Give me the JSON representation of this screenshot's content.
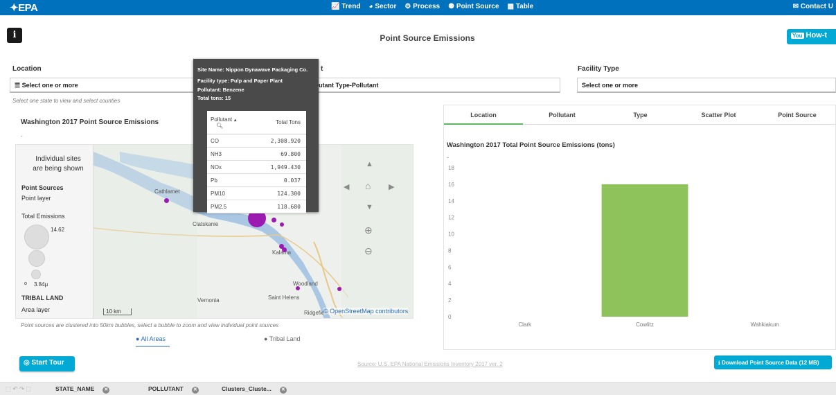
{
  "header": {
    "logo": "✦EPA",
    "nav": [
      {
        "icon": "trend-icon",
        "label": "Trend"
      },
      {
        "icon": "sector-icon",
        "label": "Sector"
      },
      {
        "icon": "process-icon",
        "label": "Process"
      },
      {
        "icon": "map-pin-icon",
        "label": "Point Source"
      },
      {
        "icon": "table-icon",
        "label": "Table"
      }
    ],
    "contact": "Contact U"
  },
  "page": {
    "title": "Point Source Emissions",
    "howto_label": "How-t",
    "youtube_badge": "You"
  },
  "filters": {
    "location_label": "Location",
    "location_placeholder": "Select one or more",
    "pollutant_label": "t",
    "pollutant_placeholder": "utant Type-Pollutant",
    "facility_label": "Facility Type",
    "facility_placeholder": "Select one or more",
    "hint": "Select one state to view and select counties"
  },
  "map_section": {
    "title": "Washington 2017 Point Source Emissions",
    "dash": "-",
    "legend": {
      "individual_line1": "Individual sites",
      "individual_line2": "are being shown",
      "point_sources": "Point Sources",
      "point_layer": "Point layer",
      "total_emissions": "Total Emissions",
      "max_value": "14.62",
      "min_value": "3.84μ",
      "min_marker": "o",
      "tribal_land": "TRIBAL LAND",
      "area_layer": "Area layer"
    },
    "places": [
      "Cathlamet",
      "Clatskanie",
      "Kalama",
      "Woodland",
      "Saint Helens",
      "Vernonia",
      "Ridgefield"
    ],
    "scale": "10 km",
    "attribution": "© OpenStreetMap contributors",
    "footnote": "Point sources are clustered into 50km bubbles, select a bubble to zoom and view individual point sources",
    "area_tabs": [
      "All Areas",
      "Tribal Land"
    ]
  },
  "tooltip": {
    "site": "Site Name: Nippon Dynawave Packaging Co.",
    "facility": "Facility type: Pulp and Paper Plant",
    "pollutant": "Pollutant: Benzene",
    "total": "Total tons: 15",
    "table_headers": [
      "Pollutant",
      "Total Tons"
    ],
    "rows": [
      {
        "pollutant": "CO",
        "tons": "2,308.920"
      },
      {
        "pollutant": "NH3",
        "tons": "69.800"
      },
      {
        "pollutant": "NOx",
        "tons": "1,949.430"
      },
      {
        "pollutant": "Pb",
        "tons": "0.037"
      },
      {
        "pollutant": "PM10",
        "tons": "124.300"
      },
      {
        "pollutant": "PM2.5",
        "tons": "118.680"
      }
    ]
  },
  "panel": {
    "tabs": [
      "Location",
      "Pollutant",
      "Type",
      "Scatter Plot",
      "Point Source"
    ],
    "chart_title": "Washington 2017 Total Point Source Emissions (tons)",
    "dash": "-"
  },
  "chart_data": {
    "type": "bar",
    "title": "Washington 2017 Total Point Source Emissions (tons)",
    "categories": [
      "Clark",
      "Cowlitz",
      "Wahkiakum"
    ],
    "values": [
      0,
      16,
      0
    ],
    "ylim": [
      0,
      18
    ],
    "yticks": [
      0,
      2,
      4,
      6,
      8,
      10,
      12,
      14,
      16,
      18
    ],
    "color": "#8dc35a",
    "grid": false
  },
  "footer": {
    "start_tour": "Start Tour",
    "source": "Source: U.S. EPA National Emissions Inventory 2017 ver. 2",
    "download": "Download Point Source Data (12 MB)"
  },
  "selection_bar": [
    {
      "label": "STATE_NAME"
    },
    {
      "label": "POLLUTANT"
    },
    {
      "label": "Clusters_Cluste..."
    }
  ],
  "colors": {
    "brand": "#0071bc",
    "accent": "#00aad4",
    "bubble": "#9c1ab1",
    "bar": "#8dc35a"
  }
}
